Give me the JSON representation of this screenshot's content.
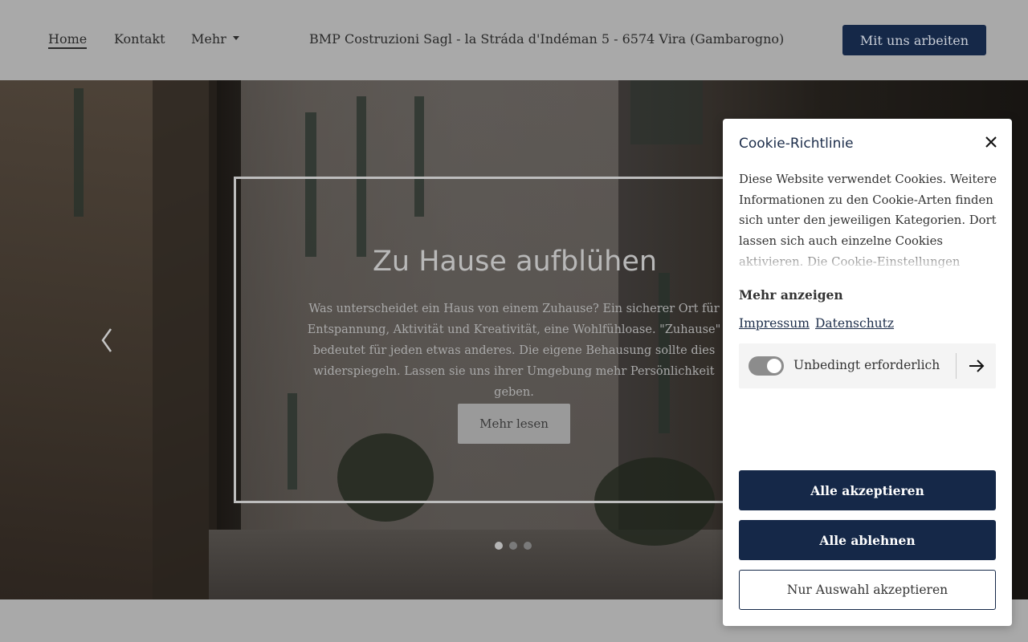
{
  "header": {
    "nav": [
      {
        "label": "Home"
      },
      {
        "label": "Kontakt"
      },
      {
        "label": "Mehr"
      }
    ],
    "address": "BMP Costruzioni Sagl - la Stráda d'Indéman 5 - 6574 Vira (Gambarogno)",
    "cta_label": "Mit uns arbeiten"
  },
  "hero": {
    "title": "Zu Hause aufblühen",
    "text": "Was unterscheidet ein Haus von einem Zuhause? Ein sicherer Ort für Entspannung, Aktivität und Kreativität, eine Wohlfühloase. \"Zuhause\" bedeutet für jeden etwas anderes. Die eigene Behausung sollte dies widerspiegeln. Lassen sie uns ihrer Umgebung mehr Persönlichkeit geben.",
    "button_label": "Mehr lesen",
    "slides_total": 3,
    "active_slide": 1
  },
  "cookie": {
    "title": "Cookie-Richtlinie",
    "text": "Diese Website verwendet Cookies. Weitere Informationen zu den Cookie-Arten finden sich unter den jeweiligen Kategorien. Dort lassen sich auch einzelne Cookies aktivieren. Die Cookie-Einstellungen können jederzeit",
    "show_more": "Mehr anzeigen",
    "links": {
      "impressum": "Impressum",
      "datenschutz": "Datenschutz"
    },
    "category_label": "Unbedingt erforderlich",
    "category_enabled": true,
    "accept_all": "Alle akzeptieren",
    "reject_all": "Alle ablehnen",
    "accept_selection": "Nur Auswahl akzeptieren"
  },
  "colors": {
    "brand_navy": "#152848",
    "overlay_gray": "#a9a9a9"
  },
  "icons": {
    "close": "close-icon",
    "carousel_prev": "chevron-left-icon",
    "category_details": "arrow-right-icon",
    "dropdown": "caret-down-icon"
  }
}
